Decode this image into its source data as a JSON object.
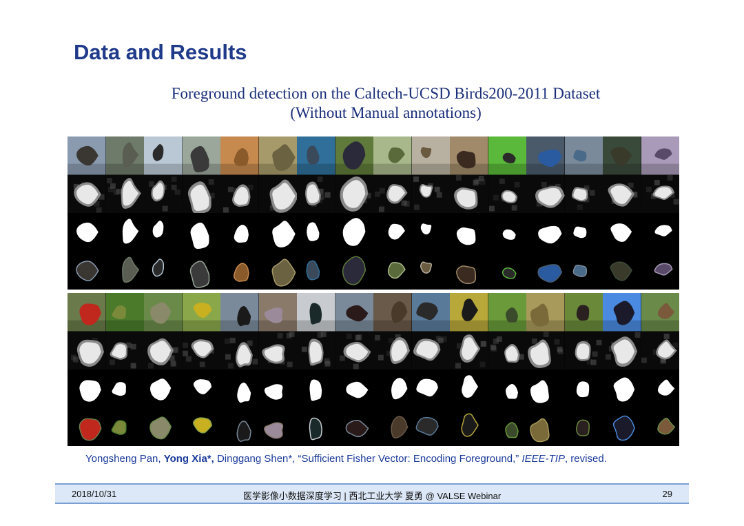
{
  "slide": {
    "title": "Data and Results",
    "subtitle_line1": "Foreground detection on the Caltech-UCSD Birds200-2011 Dataset",
    "subtitle_line2": "(Without Manual annotations)"
  },
  "figure": {
    "row_types": [
      "photo",
      "saliency-map",
      "binary-mask",
      "segmented-bird"
    ],
    "top_panel": {
      "photo_colors": [
        "#8a9bb0",
        "#6e7a6a",
        "#b9c8d4",
        "#9aa79a",
        "#c78a4e",
        "#a69a6a",
        "#2f6f9a",
        "#5f7a3a",
        "#a8b88a",
        "#b8b0a0",
        "#a08a6a",
        "#5ab83a",
        "#4a5a6a",
        "#7a8a9a",
        "#3a4a3a",
        "#a89ab8"
      ],
      "bird_colors": [
        "#3a3632",
        "#5a5e52",
        "#2a2a2a",
        "#3a3a3a",
        "#8a5a2a",
        "#6a6240",
        "#3a4a5a",
        "#2a2a3a",
        "#5a6a3a",
        "#6a5a40",
        "#3a2a20",
        "#2a2a2a",
        "#2a5aa0",
        "#4a6a8a",
        "#3a3a2a",
        "#5a4a6a"
      ]
    },
    "bottom_panel": {
      "photo_colors": [
        "#6a7a4a",
        "#4a7a2a",
        "#6a8a4a",
        "#8aa84a",
        "#7a8a9a",
        "#8a7a6a",
        "#c8ccd0",
        "#7a8a9a",
        "#6a5a4a",
        "#5a7a9a",
        "#b8a83a",
        "#6a9a3a",
        "#a89a5a",
        "#6a8a3a",
        "#4a8ae0",
        "#6a8a4a"
      ],
      "bird_colors": [
        "#c0281e",
        "#7a8a3a",
        "#8a8a6a",
        "#c8b020",
        "#1a1a1a",
        "#9a8a9a",
        "#1a2a2a",
        "#2a1a1a",
        "#4a3a2a",
        "#2a2a2a",
        "#1a1a1a",
        "#3a4a2a",
        "#7a6a3a",
        "#2a2020",
        "#1a1a2a",
        "#7a5a3a"
      ]
    }
  },
  "citation": {
    "authors_a": "Yongsheng Pan, ",
    "authors_b": "Yong Xia*,",
    "authors_c": " Dinggang Shen*, “Sufficient Fisher Vector: Encoding Foreground,” ",
    "journal": "IEEE-TIP",
    "tail": ", revised."
  },
  "footer": {
    "date": "2018/10/31",
    "center": "医学影像小数据深度学习 | 西北工业大学 夏勇 @ VALSE Webinar",
    "page": "29"
  }
}
